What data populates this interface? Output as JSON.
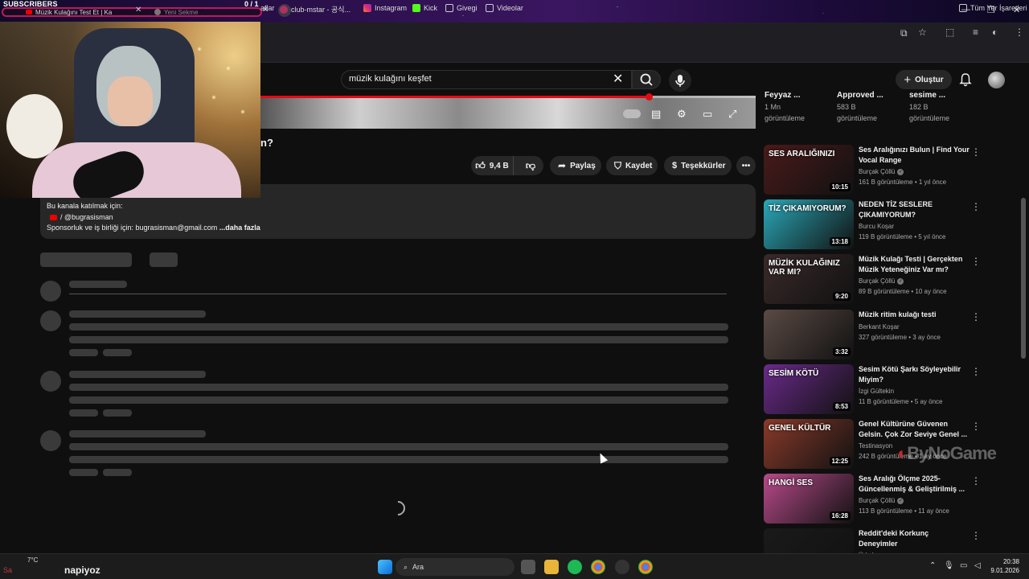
{
  "stream_overlay": {
    "subscribers_label": "SUBSCRIBERS",
    "subscribers_count": "0 / 1",
    "bottom_text": "napiyoz",
    "bottom_left_text": "Sa",
    "watermark": "ByNoGame"
  },
  "browser": {
    "tabs": [
      {
        "label": "Müzik Kulağını Test Et | Ka"
      },
      {
        "label": "Yeni Sekme"
      }
    ],
    "bookmarks": [
      {
        "label": "aflar"
      },
      {
        "label": "club-mstar - 공식..."
      },
      {
        "label": "Instagram"
      },
      {
        "label": "Kick"
      },
      {
        "label": "Givegi"
      },
      {
        "label": "Videolar"
      }
    ],
    "all_bookmarks_label": "Tüm Yer İşaretleri"
  },
  "youtube": {
    "search_value": "müzik kulağını keşfet",
    "create_label": "Oluştur",
    "video_title_fragment": "n?",
    "actions": {
      "likes": "9,4 B",
      "share": "Paylaş",
      "save": "Kaydet",
      "thanks": "Teşekkürler"
    },
    "description": {
      "line1": "Bu kanala katılmak için:",
      "line2": "/ @bugrasisman",
      "line3": "Sponsorluk ve iş birliği için: bugrasisman@gmail.com",
      "more": "...daha fazla"
    },
    "top_row": [
      {
        "title": "Feyyaz ...",
        "views": "1 Mn",
        "views_label": "görüntüleme"
      },
      {
        "title": "Approved ...",
        "views": "583 B",
        "views_label": "görüntüleme"
      },
      {
        "title": "sesime ...",
        "views": "182 B",
        "views_label": "görüntüleme"
      }
    ],
    "recommendations": [
      {
        "title": "Ses Aralığınızı Bulun | Find Your Vocal Range",
        "channel": "Burçak Çöllü",
        "verified": true,
        "meta": "161 B görüntüleme • 1 yıl önce",
        "duration": "10:15",
        "thumb_caption": "SES ARALIĞINIZI",
        "thumb_color": "#4a1a1a"
      },
      {
        "title": "NEDEN TİZ SESLERE ÇIKAMIYORUM?",
        "channel": "Burcu Koşar",
        "verified": false,
        "meta": "119 B görüntüleme • 5 yıl önce",
        "duration": "13:18",
        "thumb_caption": "TİZ ÇIKAMIYORUM?",
        "thumb_color": "#2aa8b8"
      },
      {
        "title": "Müzik Kulağı Testi | Gerçekten Müzik Yeteneğiniz Var mı?",
        "channel": "Burçak Çöllü",
        "verified": true,
        "meta": "89 B görüntüleme • 10 ay önce",
        "duration": "9:20",
        "thumb_caption": "MÜZİK KULAĞINIZ VAR MI?",
        "thumb_color": "#3a2a2a"
      },
      {
        "title": "Müzik ritim kulağı testi",
        "channel": "Berkant Koşar",
        "verified": false,
        "meta": "327 görüntüleme • 3 ay önce",
        "duration": "3:32",
        "thumb_caption": "",
        "thumb_color": "#5a4a44"
      },
      {
        "title": "Sesim Kötü Şarkı Söyleyebilir Miyim?",
        "channel": "İzgi Gültekin",
        "verified": false,
        "meta": "11 B görüntüleme • 5 ay önce",
        "duration": "8:53",
        "thumb_caption": "SESİM KÖTÜ",
        "thumb_color": "#6a2a8a"
      },
      {
        "title": "Genel Kültürüne Güvenen Gelsin. Çok Zor Seviye Genel ...",
        "channel": "Testinasyon",
        "verified": false,
        "meta": "242 B görüntüleme • 1 ay önce",
        "duration": "12:25",
        "thumb_caption": "GENEL KÜLTÜR",
        "thumb_color": "#8a3a2a"
      },
      {
        "title": "Ses Aralığı Ölçme 2025- Güncellenmiş & Geliştirilmiş ...",
        "channel": "Burçak Çöllü",
        "verified": true,
        "meta": "113 B görüntüleme • 11 ay önce",
        "duration": "16:28",
        "thumb_caption": "HANGİ SES",
        "thumb_color": "#b84a8a"
      },
      {
        "title": "Reddit'deki Korkunç Deneyimler",
        "channel": "Ürkek",
        "verified": false,
        "meta": "",
        "duration": "",
        "thumb_caption": "",
        "thumb_color": "#1a1a1a"
      }
    ]
  },
  "taskbar": {
    "weather_temp": "7°C",
    "search_placeholder": "Ara",
    "time": "20:38",
    "date": "9.01.2026"
  },
  "icons": [
    "search-icon",
    "mic-icon",
    "close-icon",
    "bell-icon",
    "plus-icon",
    "like-icon",
    "dislike-icon",
    "share-icon",
    "save-icon",
    "thanks-icon",
    "more-icon",
    "settings-icon",
    "subtitles-icon",
    "fullscreen-icon",
    "windows-icon"
  ]
}
